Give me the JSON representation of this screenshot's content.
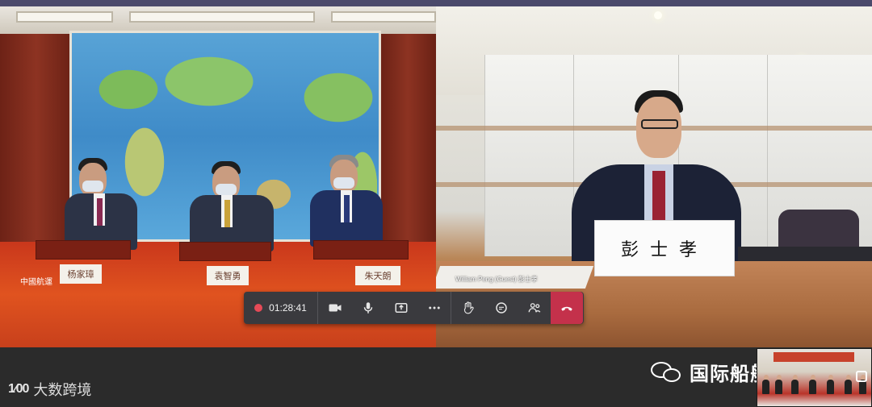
{
  "meeting": {
    "recording_time": "01:28:41"
  },
  "left_tile": {
    "logo_text": "中國航運",
    "nameplates": [
      "杨家璋",
      "袁智勇",
      "朱天朗"
    ]
  },
  "right_tile": {
    "nameplate": "彭士孝",
    "participant_label": "William Peng (Guest) 彭士孝"
  },
  "controls": {
    "icons": [
      "record-dot",
      "camera-icon",
      "microphone-icon",
      "share-screen-icon",
      "more-icon",
      "raise-hand-icon",
      "chat-icon",
      "participants-icon",
      "hang-up-icon"
    ],
    "hangup_color": "#c4314b",
    "bar_color": "#3a3a3e"
  },
  "bottom": {
    "left_logo_mark": "1⁄00",
    "left_logo_text": "大数跨境",
    "right_brand_text": "国际船舶海工网"
  }
}
